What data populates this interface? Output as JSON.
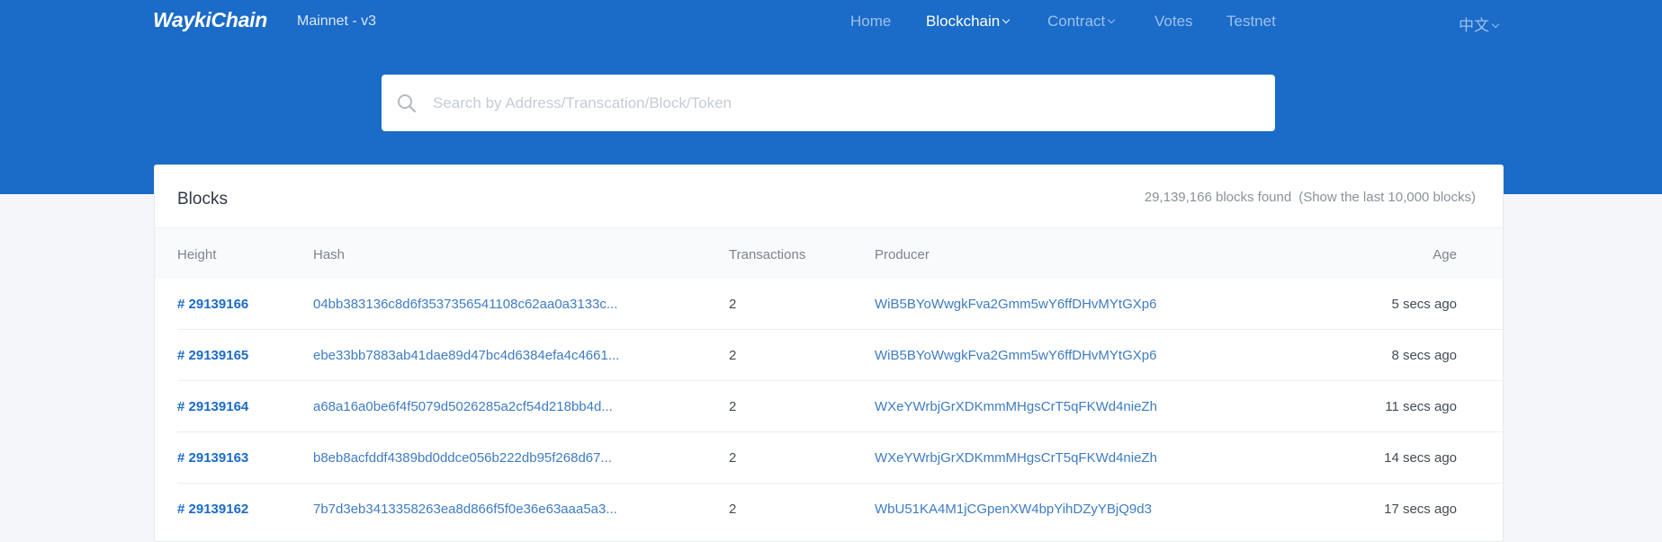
{
  "brand": {
    "logo": "WaykiChain",
    "network": "Mainnet - v3"
  },
  "nav": {
    "items": [
      {
        "label": "Home"
      },
      {
        "label": "Blockchain"
      },
      {
        "label": "Contract"
      },
      {
        "label": "Votes"
      },
      {
        "label": "Testnet"
      }
    ],
    "language": "中文"
  },
  "search": {
    "placeholder": "Search by Address/Transcation/Block/Token",
    "value": ""
  },
  "blocks": {
    "title": "Blocks",
    "count_text": "29,139,166 blocks found",
    "limit_text": "(Show the last 10,000 blocks)",
    "columns": [
      "Height",
      "Hash",
      "Transactions",
      "Producer",
      "Age"
    ],
    "rows": [
      {
        "height": "# 29139166",
        "hash": "04bb383136c8d6f3537356541108c62aa0a3133c...",
        "tx": "2",
        "producer": "WiB5BYoWwgkFva2Gmm5wY6ffDHvMYtGXp6",
        "age": "5 secs ago"
      },
      {
        "height": "# 29139165",
        "hash": "ebe33bb7883ab41dae89d47bc4d6384efa4c4661...",
        "tx": "2",
        "producer": "WiB5BYoWwgkFva2Gmm5wY6ffDHvMYtGXp6",
        "age": "8 secs ago"
      },
      {
        "height": "# 29139164",
        "hash": "a68a16a0be6f4f5079d5026285a2cf54d218bb4d...",
        "tx": "2",
        "producer": "WXeYWrbjGrXDKmmMHgsCrT5qFKWd4nieZh",
        "age": "11 secs ago"
      },
      {
        "height": "# 29139163",
        "hash": "b8eb8acfddf4389bd0ddce056b222db95f268d67...",
        "tx": "2",
        "producer": "WXeYWrbjGrXDKmmMHgsCrT5qFKWd4nieZh",
        "age": "14 secs ago"
      },
      {
        "height": "# 29139162",
        "hash": "7b7d3eb3413358263ea8d866f5f0e36e63aaa5a3...",
        "tx": "2",
        "producer": "WbU51KA4M1jCGpenXW4bpYihDZyYBjQ9d3",
        "age": "17 secs ago"
      }
    ]
  },
  "colors": {
    "brand_blue": "#1b6bc8",
    "link_blue": "#3f7cc2",
    "page_bg": "#f4f6f9"
  }
}
